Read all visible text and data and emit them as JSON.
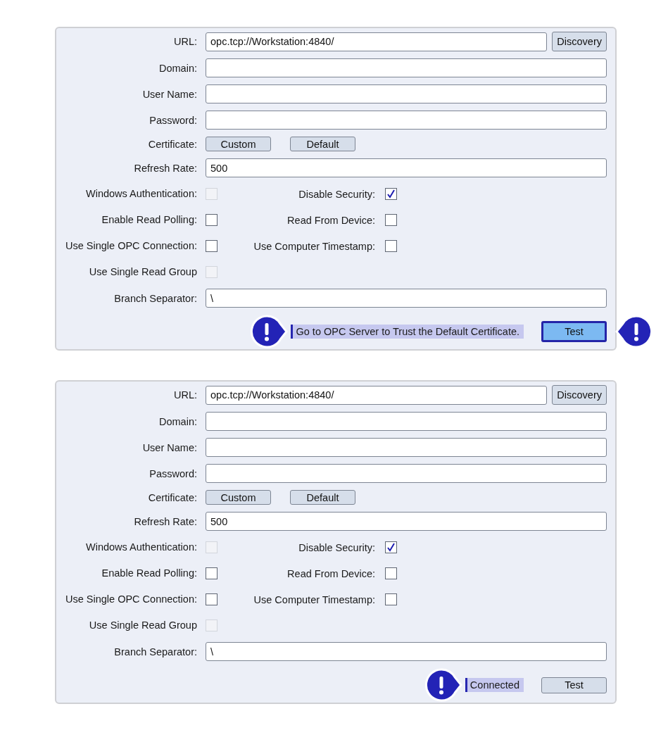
{
  "panels": [
    {
      "url": {
        "label": "URL:",
        "value": "opc.tcp://Workstation:4840/",
        "button": "Discovery"
      },
      "text_fields": [
        {
          "label": "Domain:"
        },
        {
          "label": "User Name:"
        },
        {
          "label": "Password:"
        }
      ],
      "certificate": {
        "label": "Certificate:",
        "buttons": [
          "Custom",
          "Default"
        ]
      },
      "refresh_rate": {
        "label": "Refresh Rate:",
        "value": "500"
      },
      "checkbox_rows": [
        [
          {
            "label": "Windows Authentication:",
            "checked": false,
            "disabled": true
          },
          {
            "label": "Disable Security:",
            "checked": true,
            "disabled": false
          }
        ],
        [
          {
            "label": "Enable Read Polling:",
            "checked": false,
            "disabled": false
          },
          {
            "label": "Read From Device:",
            "checked": false,
            "disabled": false
          }
        ],
        [
          {
            "label": "Use Single OPC Connection:",
            "checked": false,
            "disabled": false
          },
          {
            "label": "Use Computer Timestamp:",
            "checked": false,
            "disabled": false
          }
        ],
        [
          {
            "label": "Use Single Read Group",
            "checked": false,
            "disabled": true
          }
        ]
      ],
      "branch_separator": {
        "label": "Branch Separator:",
        "value": "\\"
      },
      "status": {
        "text": "Go to OPC Server to Trust the Default Certificate.",
        "callout": true
      },
      "test_button": {
        "label": "Test",
        "focused": true,
        "callout": true
      }
    },
    {
      "url": {
        "label": "URL:",
        "value": "opc.tcp://Workstation:4840/",
        "button": "Discovery"
      },
      "text_fields": [
        {
          "label": "Domain:"
        },
        {
          "label": "User Name:"
        },
        {
          "label": "Password:"
        }
      ],
      "certificate": {
        "label": "Certificate:",
        "buttons": [
          "Custom",
          "Default"
        ]
      },
      "refresh_rate": {
        "label": "Refresh Rate:",
        "value": "500"
      },
      "checkbox_rows": [
        [
          {
            "label": "Windows Authentication:",
            "checked": false,
            "disabled": true
          },
          {
            "label": "Disable Security:",
            "checked": true,
            "disabled": false
          }
        ],
        [
          {
            "label": "Enable Read Polling:",
            "checked": false,
            "disabled": false
          },
          {
            "label": "Read From Device:",
            "checked": false,
            "disabled": false
          }
        ],
        [
          {
            "label": "Use Single OPC Connection:",
            "checked": false,
            "disabled": false
          },
          {
            "label": "Use Computer Timestamp:",
            "checked": false,
            "disabled": false
          }
        ],
        [
          {
            "label": "Use Single Read Group",
            "checked": false,
            "disabled": true
          }
        ]
      ],
      "branch_separator": {
        "label": "Branch Separator:",
        "value": "\\"
      },
      "status": {
        "text": "Connected",
        "callout": true
      },
      "test_button": {
        "label": "Test",
        "focused": false,
        "callout": false
      }
    }
  ]
}
